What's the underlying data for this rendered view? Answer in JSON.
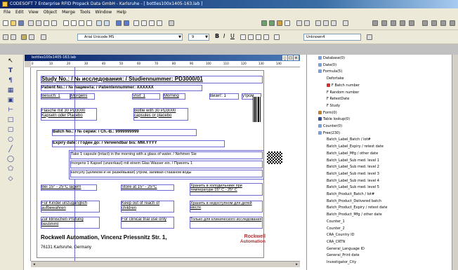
{
  "window": {
    "title": "CODESOFT 7 Enterprise RFID Propack Data GmbH - Karlsruhe - [ bottles100x1405-163.lab ]"
  },
  "menu": [
    "File",
    "Edit",
    "View",
    "Object",
    "Merge",
    "Tools",
    "Window",
    "Help"
  ],
  "font_toolbar": {
    "font_name": "Arial Unicode MS",
    "font_size": "9",
    "variable_field": "Unknown4"
  },
  "document": {
    "title": "bottles100x1405-163.lab"
  },
  "ruler": [
    "0",
    "10",
    "20",
    "30",
    "40",
    "50",
    "60",
    "70",
    "80",
    "90",
    "100",
    "110",
    "120",
    "130",
    "140"
  ],
  "label": {
    "study": "Study No.: / № исследования: / Studiennummer:  PD3000/01",
    "patient": "Patient No.: / № пациента: / Patientennummer:  XXXXXX",
    "visit_label": "Besuch: 1",
    "morgens": "Morgens",
    "visit1": "Visit: 1",
    "morning": "Morning",
    "visit_ru": "Визит: 1",
    "utrom": "утром",
    "flasche": "Flasche mit 30 PD3000 Kapseln oder Placebo",
    "bottle": "Bottle with 30 PD3000 capsules or placebo",
    "batch": "Batch No.: / № серии: / Ch.-B.:  9999999999",
    "expiry": "Expiry date: / Годен до: / Verwendbar bis:  MM.YYYY",
    "instr1": "Take 1 capsule (intact) in the morning with a glass of water. / Nehmen Sie",
    "instr2": "morgens 1 Kapsel (unzerkaut) mit einem Glas Wasser ein. / Принять 1",
    "instr3": "капсулу (целиком и не разжёвывая) утром, запивая стаканом воды",
    "store_de": "Bei 15° - 25°C lagern",
    "store_en": "Store at 15° - 25°C",
    "store_ru": "Хранить в холодильнике при температуре 15° C - 25° C",
    "kids_de": "Für Kinder unzugänglich aufbewahren",
    "kids_en": "Keep out of reach of children",
    "kids_ru": "Хранить в недоступном для детей месте",
    "clin_de": "Zur klinischen Prüfung bestimmt",
    "clin_en": "For clinical trial use only",
    "clin_ru": "Только для клинического исследования",
    "company": "Rockwell Automation, Vincenz Priessnitz Str. 1,",
    "city": "76131 Karlsruhe, Germany",
    "logo_top": "Rockwell",
    "logo_bottom": "Automation"
  },
  "tree": [
    {
      "label": "Database(0)",
      "indent": 1,
      "color": "#7a9fd4"
    },
    {
      "label": "Date(0)",
      "indent": 1,
      "color": "#7a9fd4"
    },
    {
      "label": "Formula(5)",
      "indent": 1,
      "color": "#7a9fd4"
    },
    {
      "label": "Defortake",
      "indent": 3,
      "color": ""
    },
    {
      "label": "F Batch number",
      "indent": 3,
      "color": "#d03030"
    },
    {
      "label": "F Random number",
      "indent": 3,
      "color": ""
    },
    {
      "label": "F RetestDate",
      "indent": 3,
      "color": ""
    },
    {
      "label": "F Study",
      "indent": 3,
      "color": ""
    },
    {
      "label": "Form(0)",
      "indent": 1,
      "color": "#c08030"
    },
    {
      "label": "Table lookup(0)",
      "indent": 1,
      "color": "#305090"
    },
    {
      "label": "Counter(0)",
      "indent": 1,
      "color": "#7a9fd4"
    },
    {
      "label": "Free(230)",
      "indent": 1,
      "color": "#7a9fd4"
    },
    {
      "label": "Batch_Label_Batch / lot#",
      "indent": 3,
      "color": ""
    },
    {
      "label": "Batch_Label_Expiry / retest date",
      "indent": 3,
      "color": ""
    },
    {
      "label": "Batch_Label_Mfg / other date",
      "indent": 3,
      "color": ""
    },
    {
      "label": "Batch_Label_Sub med. level 1",
      "indent": 3,
      "color": ""
    },
    {
      "label": "Batch_Label_Sub med. level 2",
      "indent": 3,
      "color": ""
    },
    {
      "label": "Batch_Label_Sub med. level 3",
      "indent": 3,
      "color": ""
    },
    {
      "label": "Batch_Label_Sub med. level 4",
      "indent": 3,
      "color": ""
    },
    {
      "label": "Batch_Label_Sub med. level 5",
      "indent": 3,
      "color": ""
    },
    {
      "label": "Batch_Product_Batch / lot#",
      "indent": 3,
      "color": ""
    },
    {
      "label": "Batch_Product_Delivered batch",
      "indent": 3,
      "color": ""
    },
    {
      "label": "Batch_Product_Expiry / retest date",
      "indent": 3,
      "color": ""
    },
    {
      "label": "Batch_Product_Mfg / other date",
      "indent": 3,
      "color": ""
    },
    {
      "label": "Counter_1",
      "indent": 3,
      "color": ""
    },
    {
      "label": "Counter_2",
      "indent": 3,
      "color": ""
    },
    {
      "label": "CRA_Country ID",
      "indent": 3,
      "color": ""
    },
    {
      "label": "CRA_CRTN",
      "indent": 3,
      "color": ""
    },
    {
      "label": "General_Language ID",
      "indent": 3,
      "color": ""
    },
    {
      "label": "General_Print date",
      "indent": 3,
      "color": ""
    },
    {
      "label": "Investigator_City",
      "indent": 3,
      "color": ""
    }
  ]
}
